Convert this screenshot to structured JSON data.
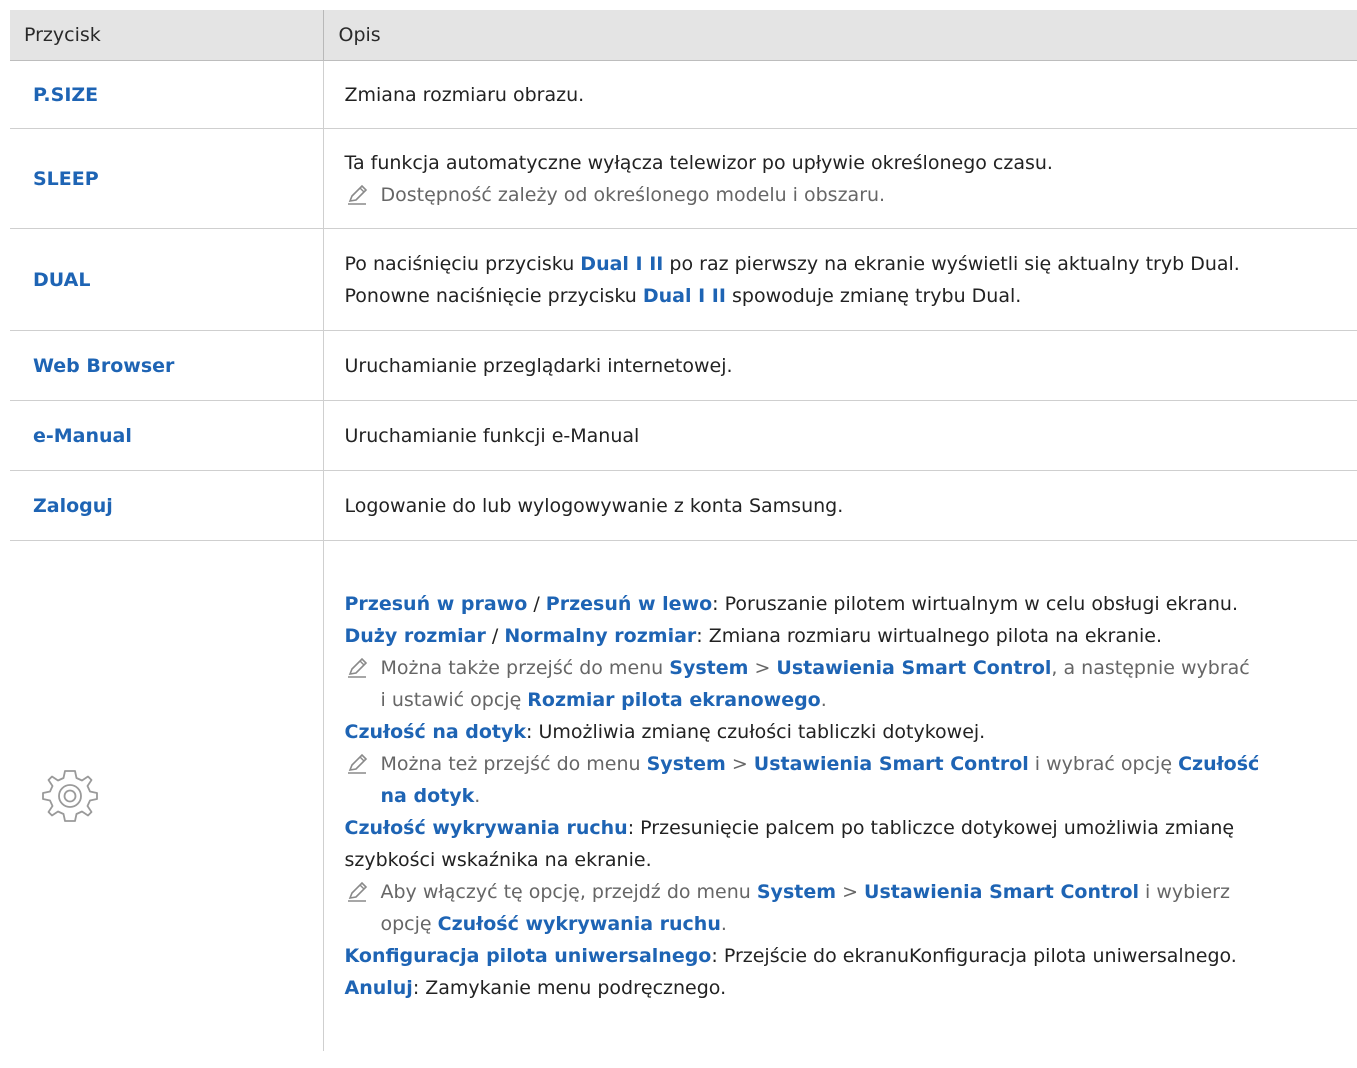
{
  "header": {
    "col1": "Przycisk",
    "col2": "Opis"
  },
  "rows": [
    {
      "key": "P.SIZE",
      "desc": "Zmiana rozmiaru obrazu."
    },
    {
      "key": "SLEEP",
      "desc": "Ta funkcja automatyczne wyłącza telewizor po upływie określonego czasu.",
      "note": "Dostępność zależy od określonego modelu i obszaru."
    },
    {
      "key": "DUAL",
      "p1a": "Po naciśnięciu przycisku ",
      "p1b": "Dual I II",
      "p1c": " po raz pierwszy na ekranie wyświetli się aktualny tryb Dual.",
      "p2a": "Ponowne naciśnięcie przycisku ",
      "p2b": "Dual I II",
      "p2c": " spowoduje zmianę trybu Dual."
    },
    {
      "key": "Web Browser",
      "desc": "Uruchamianie przeglądarki internetowej."
    },
    {
      "key": "e-Manual",
      "desc": "Uruchamianie funkcji e-Manual"
    },
    {
      "key": "Zaloguj",
      "desc": "Logowanie do lub wylogowywanie z konta Samsung."
    }
  ],
  "gear_row": {
    "icon": "gear-icon",
    "l1a": "Przesuń w prawo",
    "l1b": " / ",
    "l1c": "Przesuń w lewo",
    "l1d": ": Poruszanie pilotem wirtualnym w celu obsługi ekranu.",
    "l2a": "Duży rozmiar",
    "l2b": " / ",
    "l2c": "Normalny rozmiar",
    "l2d": ": Zmiana rozmiaru wirtualnego pilota na ekranie.",
    "n1a": "Można także przejść do menu ",
    "n1b": "System",
    "n1c": " > ",
    "n1d": "Ustawienia Smart Control",
    "n1e": ", a następnie wybrać",
    "n1f": "i ustawić opcję ",
    "n1g": "Rozmiar pilota ekranowego",
    "n1h": ".",
    "l3a": "Czułość na dotyk",
    "l3b": ": Umożliwia zmianę czułości tabliczki dotykowej.",
    "n2a": "Można też przejść do menu ",
    "n2b": "System",
    "n2c": " > ",
    "n2d": "Ustawienia Smart Control",
    "n2e": " i wybrać opcję ",
    "n2f": "Czułość",
    "n2g": "na dotyk",
    "n2h": ".",
    "l4a": "Czułość wykrywania ruchu",
    "l4b": ": Przesunięcie palcem po tabliczce dotykowej umożliwia zmianę",
    "l4c": "szybkości wskaźnika na ekranie.",
    "n3a": "Aby włączyć tę opcję, przejdź do menu ",
    "n3b": "System",
    "n3c": " > ",
    "n3d": "Ustawienia Smart Control",
    "n3e": " i wybierz",
    "n3f": "opcję ",
    "n3g": "Czułość wykrywania ruchu",
    "n3h": ".",
    "l5a": "Konfiguracja pilota uniwersalnego",
    "l5b": ": Przejście do ekranuKonfiguracja pilota uniwersalnego.",
    "l6a": "Anuluj",
    "l6b": ": Zamykanie menu podręcznego."
  },
  "colors": {
    "header_bg": "#e4e4e4",
    "link_blue": "#1e64b4",
    "note_gray": "#666666"
  }
}
